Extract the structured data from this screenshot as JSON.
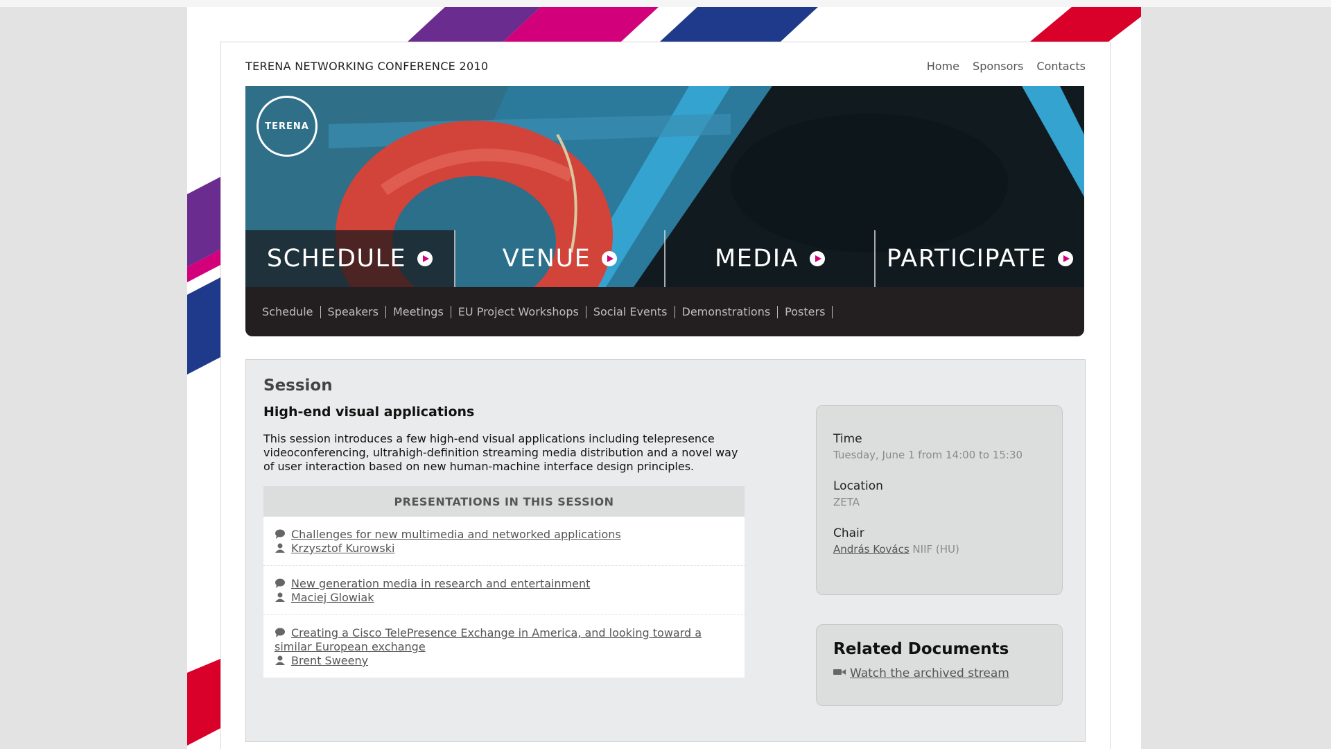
{
  "header": {
    "site_title": "TERENA NETWORKING CONFERENCE 2010",
    "links": [
      "Home",
      "Sponsors",
      "Contacts"
    ]
  },
  "banner": {
    "logo_text": "TERENA",
    "main_nav": [
      "SCHEDULE",
      "VENUE",
      "MEDIA",
      "PARTICIPATE"
    ],
    "sub_nav": [
      "Schedule",
      "Speakers",
      "Meetings",
      "EU Project Workshops",
      "Social Events",
      "Demonstrations",
      "Posters"
    ]
  },
  "session": {
    "heading": "Session",
    "title": "High-end visual applications",
    "description": "This session introduces a few high-end visual applications including telepresence videoconferencing, ultrahigh-definition streaming media distribution and a novel way of user interaction based on new human-machine interface design principles.",
    "presentations_header": "PRESENTATIONS IN THIS SESSION",
    "presentations": [
      {
        "title": "Challenges for new multimedia and networked applications",
        "speaker": "Krzysztof Kurowski"
      },
      {
        "title": "New generation media in research and entertainment",
        "speaker": "Maciej Glowiak"
      },
      {
        "title": "Creating a Cisco TelePresence Exchange in America, and looking toward a similar European exchange",
        "speaker": "Brent Sweeny"
      }
    ]
  },
  "info": {
    "time_label": "Time",
    "time_value": "Tuesday, June 1 from 14:00 to 15:30",
    "location_label": "Location",
    "location_value": "ZETA",
    "chair_label": "Chair",
    "chair_name": "András Kovács",
    "chair_org": "NIIF (HU)"
  },
  "documents": {
    "title": "Related Documents",
    "link": "Watch the archived stream"
  },
  "colors": {
    "purple": "#6a2c8e",
    "magenta": "#d2007a",
    "navy": "#1f3a8a",
    "red": "#d9002a"
  }
}
